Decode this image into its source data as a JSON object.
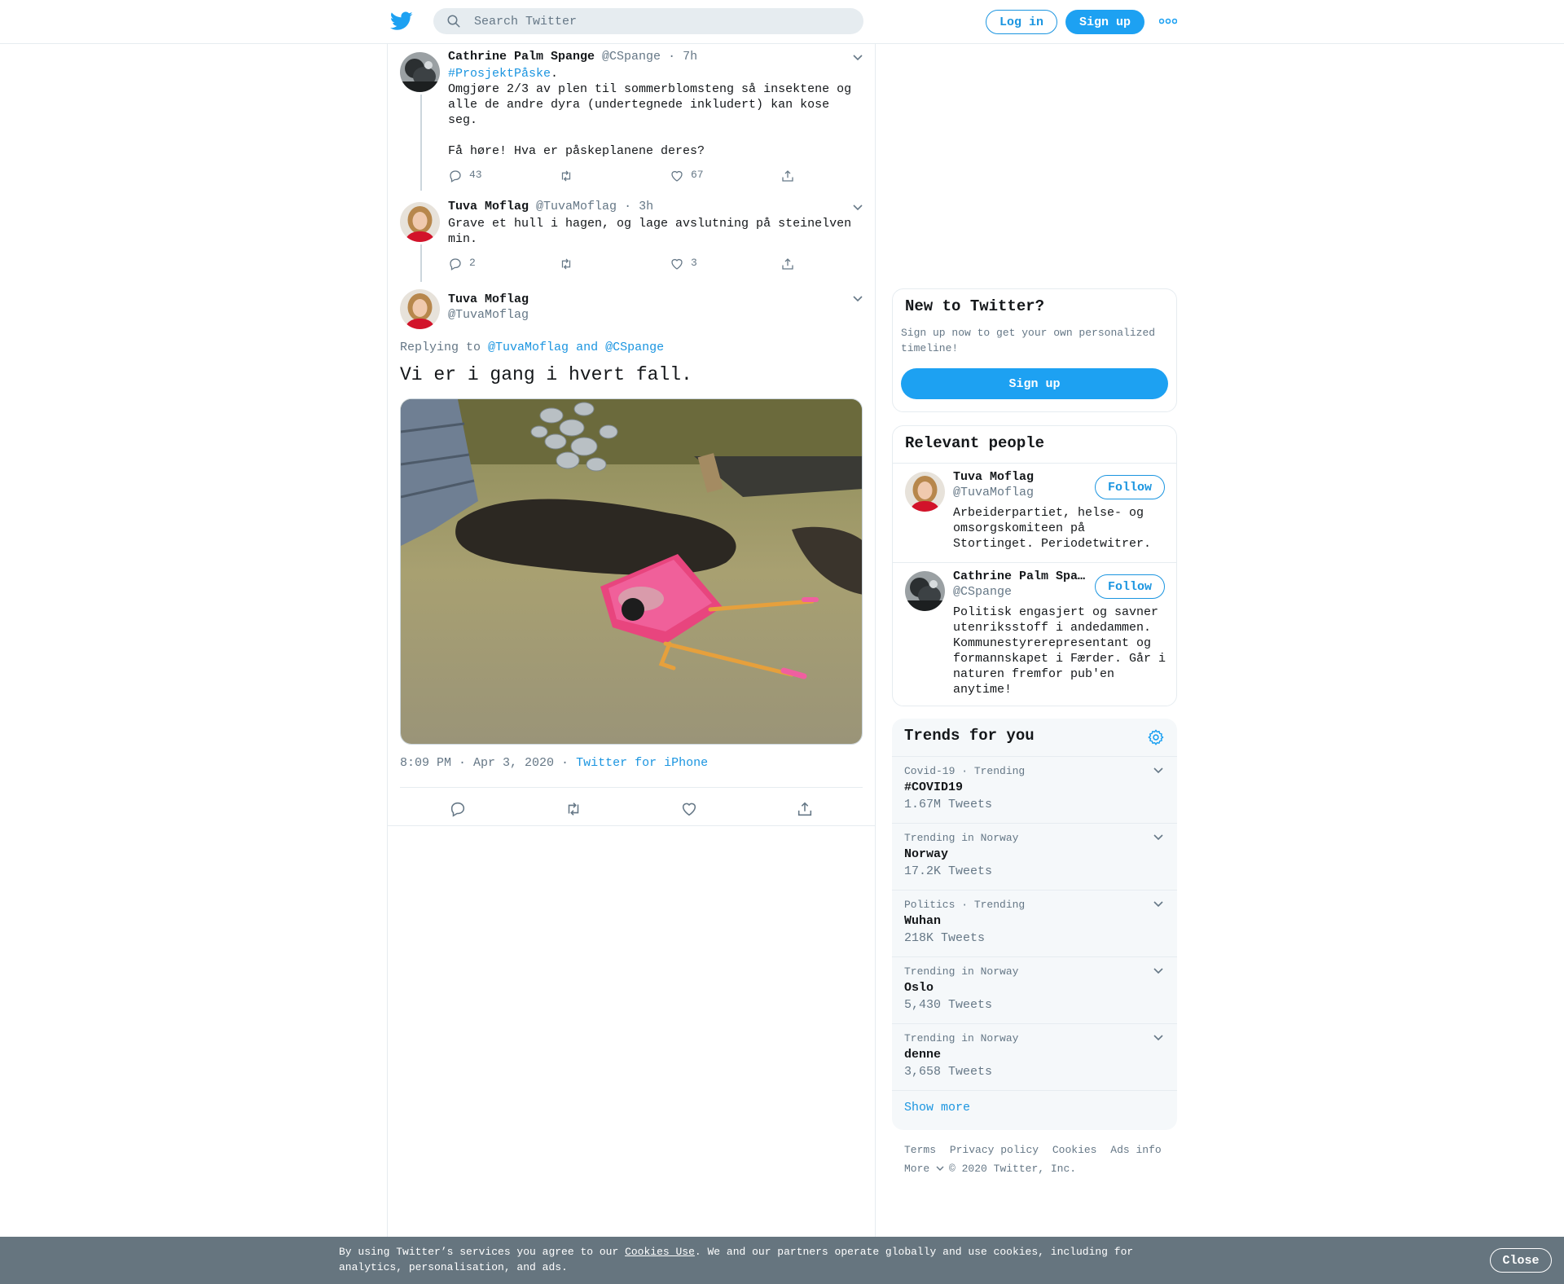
{
  "header": {
    "search_placeholder": "Search Twitter",
    "login_label": "Log in",
    "signup_label": "Sign up"
  },
  "thread": [
    {
      "name": "Cathrine Palm Spange",
      "handle": "@CSpange",
      "time": "· 7h",
      "hashtag": "#ProsjektPåske",
      "hashtag_suffix": ".",
      "text_lines": [
        "Omgjøre 2/3 av plen til sommerblomsteng så insektene og",
        "alle de andre dyra (undertegnede inkludert) kan kose",
        "seg.",
        "",
        "Få høre! Hva er påskeplanene deres?"
      ],
      "replies": "43",
      "likes": "67"
    },
    {
      "name": "Tuva Moflag",
      "handle": "@TuvaMoflag",
      "time": "· 3h",
      "text_lines": [
        "Grave et hull i hagen, og lage avslutning på steinelven",
        "min."
      ],
      "replies": "2",
      "likes": "3"
    }
  ],
  "focus_tweet": {
    "name": "Tuva Moflag",
    "handle": "@TuvaMoflag",
    "replying_prefix": "Replying to",
    "replying_to": "@TuvaMoflag and @CSpange",
    "text": "Vi er i gang i hvert fall.",
    "timestamp": "8:09 PM · Apr 3, 2020 ·",
    "source": "Twitter for iPhone"
  },
  "sidebar": {
    "new_to_twitter": {
      "title": "New to Twitter?",
      "text": "Sign up now to get your own personalized timeline!",
      "button": "Sign up"
    },
    "relevant_people": {
      "title": "Relevant people",
      "people": [
        {
          "name": "Tuva Moflag",
          "handle": "@TuvaMoflag",
          "bio": "Arbeiderpartiet, helse- og omsorgskomiteen på Stortinget. Periodetwitrer.",
          "follow": "Follow"
        },
        {
          "name": "Cathrine Palm Spange",
          "handle": "@CSpange",
          "bio": "Politisk engasjert og savner utenriksstoff i andedammen. Kommunestyrerepresentant og formannskapet i Færder. Går i naturen fremfor pub'en anytime!",
          "follow": "Follow"
        }
      ]
    },
    "trends": {
      "title": "Trends for you",
      "items": [
        {
          "context": "Covid-19 · Trending",
          "name": "#COVID19",
          "count": "1.67M Tweets"
        },
        {
          "context": "Trending in Norway",
          "name": "Norway",
          "count": "17.2K Tweets"
        },
        {
          "context": "Politics · Trending",
          "name": "Wuhan",
          "count": "218K Tweets"
        },
        {
          "context": "Trending in Norway",
          "name": "Oslo",
          "count": "5,430 Tweets"
        },
        {
          "context": "Trending in Norway",
          "name": "denne",
          "count": "3,658 Tweets"
        }
      ],
      "show_more": "Show more"
    },
    "footer": {
      "links": [
        "Terms",
        "Privacy policy",
        "Cookies",
        "Ads info"
      ],
      "more": "More",
      "copyright": "© 2020 Twitter, Inc."
    }
  },
  "cookie_bar": {
    "text_before": "By using Twitter’s services you agree to our ",
    "link": "Cookies Use",
    "text_after": ". We and our partners operate globally and use cookies, including for analytics, personalisation, and ads.",
    "close": "Close"
  },
  "colors": {
    "brand_blue": "#1da1f2",
    "link_blue": "#1b95e0",
    "secondary_text": "#657786",
    "border": "#e6ecf0",
    "cookie_bar_bg": "#66757f"
  }
}
